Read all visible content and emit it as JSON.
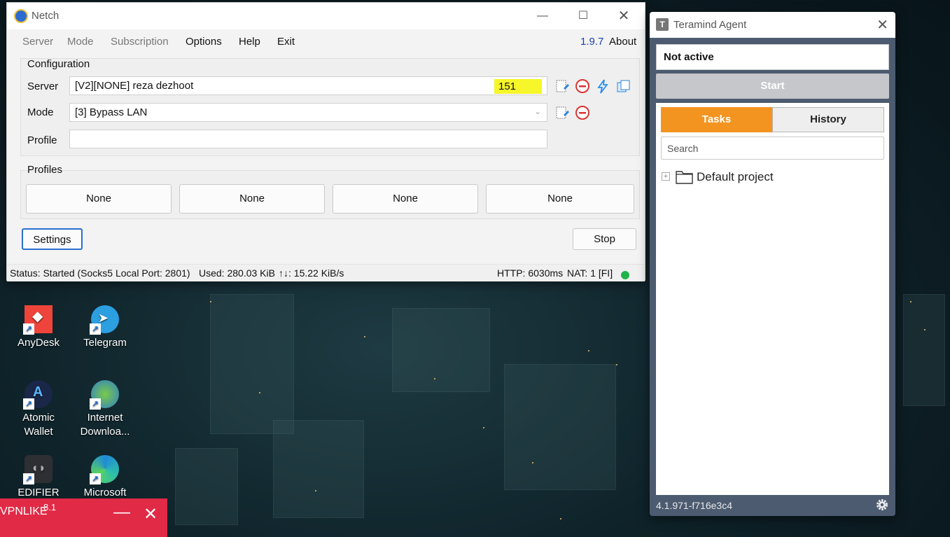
{
  "netch": {
    "title": "Netch",
    "menu": {
      "server": "Server",
      "mode": "Mode",
      "subscription": "Subscription",
      "options": "Options",
      "help": "Help",
      "exit": "Exit",
      "version": "1.9.7",
      "about": "About"
    },
    "configuration": {
      "label": "Configuration",
      "server_label": "Server",
      "server_value": "[V2][NONE] reza dezhoot",
      "server_latency": "151",
      "mode_label": "Mode",
      "mode_value": "[3] Bypass LAN",
      "profile_label": "Profile",
      "profile_value": ""
    },
    "profiles": {
      "label": "Profiles",
      "buttons": [
        "None",
        "None",
        "None",
        "None"
      ]
    },
    "settings_button": "Settings",
    "stop_button": "Stop",
    "status": {
      "main": "Status: Started (Socks5 Local Port: 2801)",
      "used": "Used: 280.03 KiB",
      "speed": "↑↓: 15.22 KiB/s",
      "http": "HTTP: 6030ms",
      "nat": "NAT: 1 [FI]"
    },
    "colors": {
      "status_dot": "#22b24c",
      "latency_highlight": "#f6f62a"
    }
  },
  "teramind": {
    "title": "Teramind Agent",
    "icon_letter": "T",
    "status": "Not active",
    "start_button": "Start",
    "tabs": [
      "Tasks",
      "History"
    ],
    "active_tab": "Tasks",
    "search_placeholder": "Search",
    "project": "Default project",
    "version": "4.1.971-f716e3c4",
    "colors": {
      "accent": "#f39421",
      "frame": "#4c5b6f"
    }
  },
  "desktop_icons": [
    {
      "label": "AnyDesk"
    },
    {
      "label": "Telegram"
    },
    {
      "label": "Atomic Wallet"
    },
    {
      "label": "Internet Downloa..."
    },
    {
      "label": "EDIFIER"
    },
    {
      "label": "Microsoft"
    }
  ],
  "vpnbar": {
    "name": "VPNLIKE",
    "version": "8.1"
  }
}
